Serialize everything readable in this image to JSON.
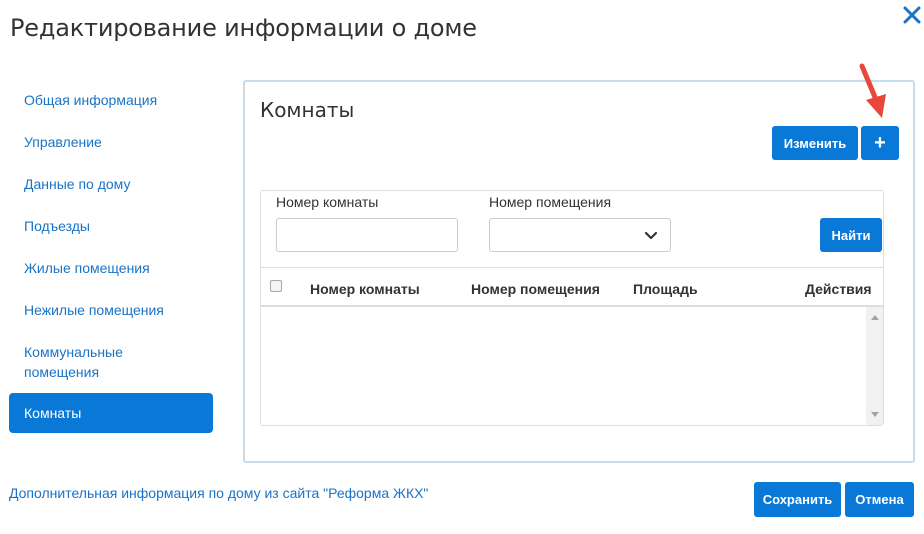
{
  "dialog": {
    "title": "Редактирование информации о доме",
    "close_icon": "close-icon"
  },
  "sidebar": {
    "items": [
      {
        "label": "Общая информация",
        "active": false
      },
      {
        "label": "Управление",
        "active": false
      },
      {
        "label": "Данные по дому",
        "active": false
      },
      {
        "label": "Подъезды",
        "active": false
      },
      {
        "label": "Жилые помещения",
        "active": false
      },
      {
        "label": "Нежилые помещения",
        "active": false
      },
      {
        "label": "Коммунальные помещения",
        "active": false
      },
      {
        "label": "Комнаты",
        "active": true
      }
    ]
  },
  "panel": {
    "title": "Комнаты",
    "edit_label": "Изменить",
    "add_label": "+",
    "filters": {
      "room_number_label": "Номер комнаты",
      "room_number_value": "",
      "premise_number_label": "Номер помещения",
      "premise_number_selected": "",
      "find_label": "Найти"
    },
    "table": {
      "columns": [
        "Номер комнаты",
        "Номер помещения",
        "Площадь",
        "Действия"
      ],
      "rows": []
    }
  },
  "footer": {
    "link_text": "Дополнительная информация по дому из сайта \"Реформа ЖКХ\"",
    "save_label": "Сохранить",
    "cancel_label": "Отмена"
  },
  "colors": {
    "primary": "#0a78d6",
    "link": "#1a73c6",
    "panel_border": "#c4dcee",
    "annotation_arrow": "#e8473a"
  }
}
